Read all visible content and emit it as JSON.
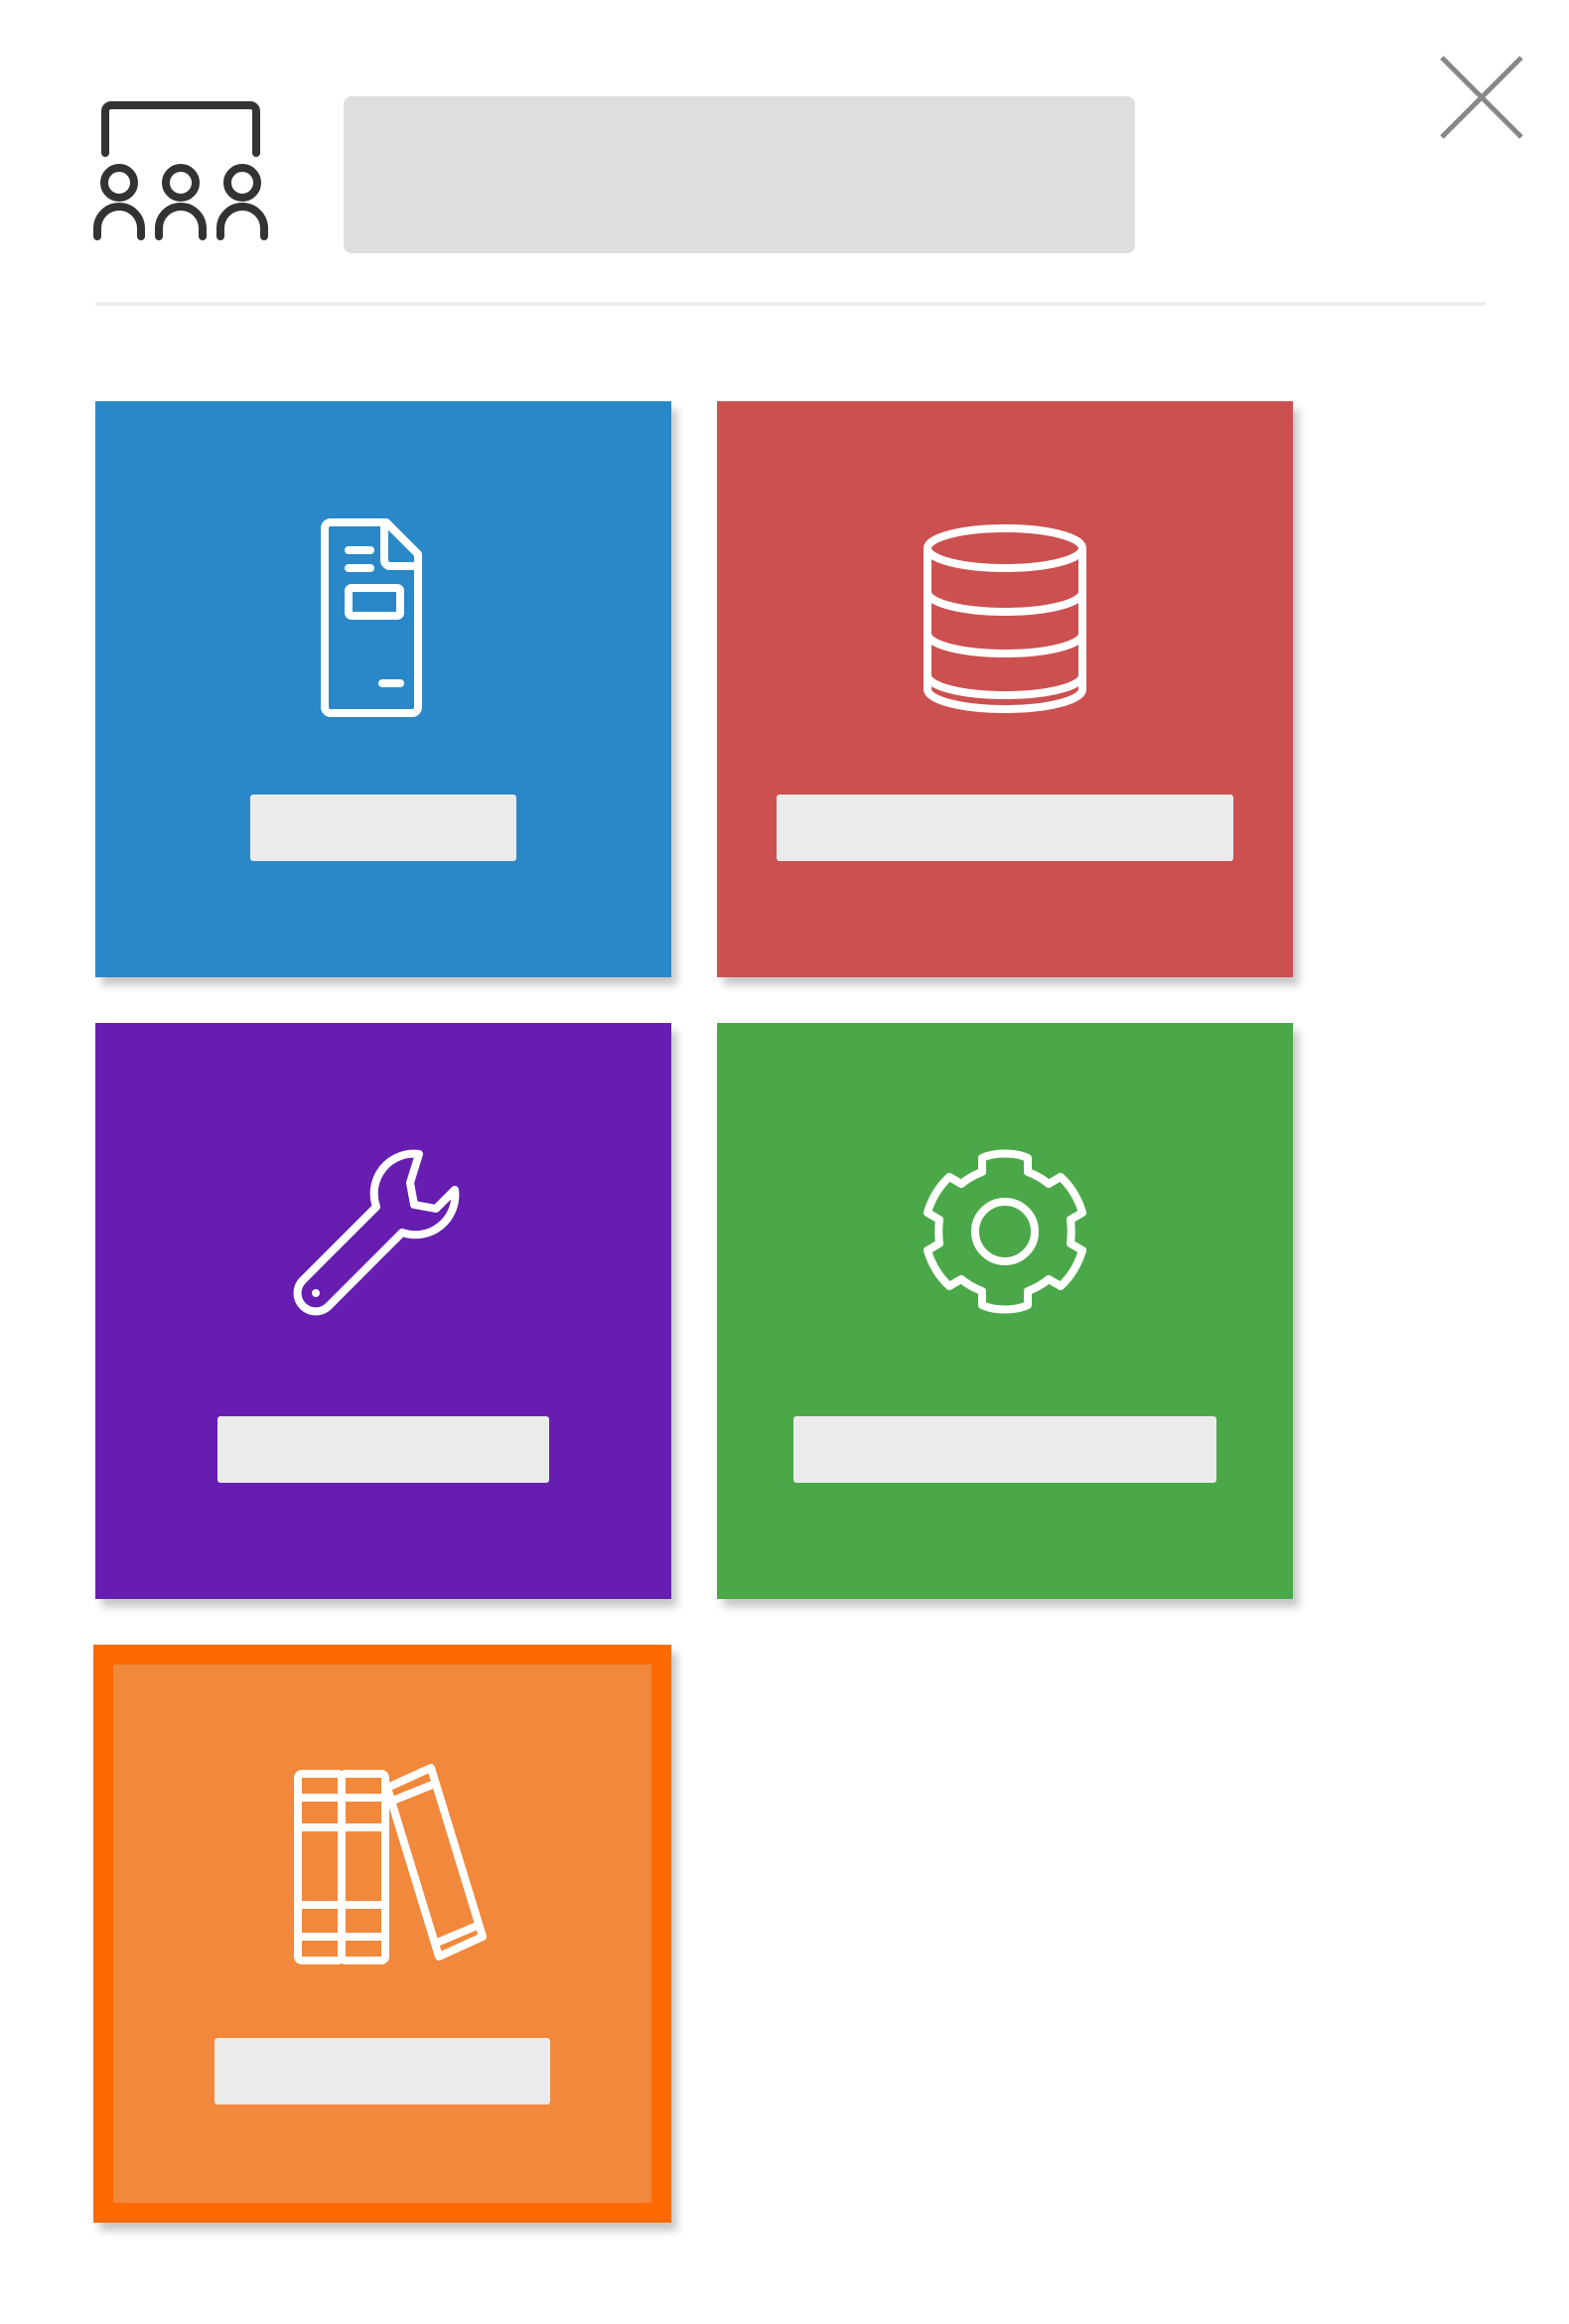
{
  "header": {
    "icon": "group-presentation-icon",
    "title": "",
    "close_icon": "close-icon"
  },
  "colors": {
    "blue": "#2a88c8",
    "red": "#cc5050",
    "purple": "#671db0",
    "green": "#4ba848",
    "orange": "#f1883b",
    "selected_border": "#ff6a00",
    "label_placeholder": "#ebebeb",
    "title_placeholder": "#dedede"
  },
  "tiles": [
    {
      "id": "forms",
      "icon": "document-form-icon",
      "label": "",
      "color": "#2a88c8",
      "selected": false
    },
    {
      "id": "database",
      "icon": "database-icon",
      "label": "",
      "color": "#cc5050",
      "selected": false
    },
    {
      "id": "tools",
      "icon": "wrench-icon",
      "label": "",
      "color": "#671db0",
      "selected": false
    },
    {
      "id": "settings",
      "icon": "gear-icon",
      "label": "",
      "color": "#4ba848",
      "selected": false
    },
    {
      "id": "library",
      "icon": "books-icon",
      "label": "",
      "color": "#f1883b",
      "selected": true
    }
  ]
}
